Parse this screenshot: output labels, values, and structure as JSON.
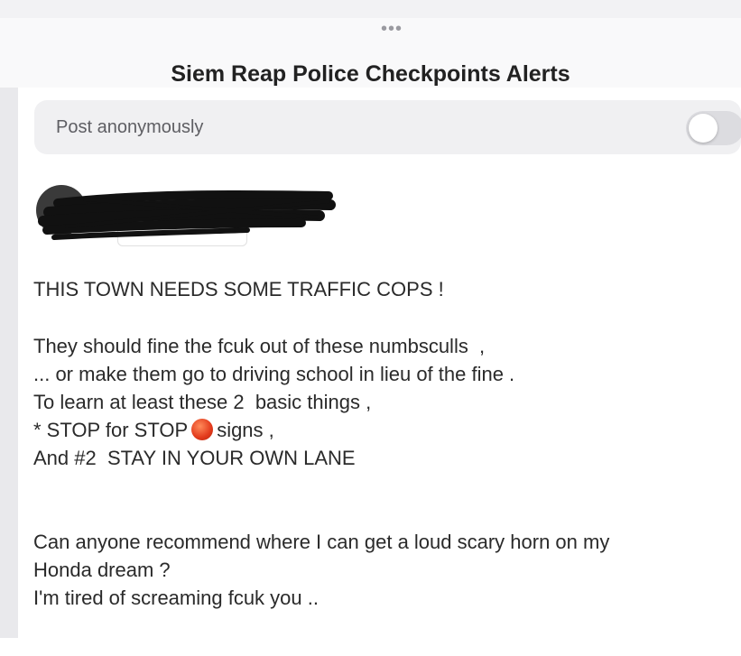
{
  "header": {
    "grabber": "•••",
    "title": "Siem Reap Police Checkpoints Alerts"
  },
  "anonymous_toggle": {
    "label": "Post anonymously",
    "enabled": false
  },
  "post": {
    "line1": "THIS TOWN NEEDS SOME TRAFFIC COPS !",
    "line2": "They should fine the fcuk out of these numbsculls  ,",
    "line3": "... or make them go to driving school in lieu of the fine .",
    "line4": "To learn at least these 2  basic things ,",
    "line5_before": "* STOP for STOP",
    "line5_emoji": "red-circle",
    "line5_after": "signs ,",
    "line6": "And #2  STAY IN YOUR OWN LANE",
    "line7": "Can anyone recommend where I can get a loud scary horn on my",
    "line8": "Honda dream ?",
    "line9": "I'm tired of screaming fcuk you .."
  },
  "colors": {
    "redaction_red": "#e0442b",
    "redaction_black": "#111111",
    "toggle_off": "#dcdce0"
  }
}
